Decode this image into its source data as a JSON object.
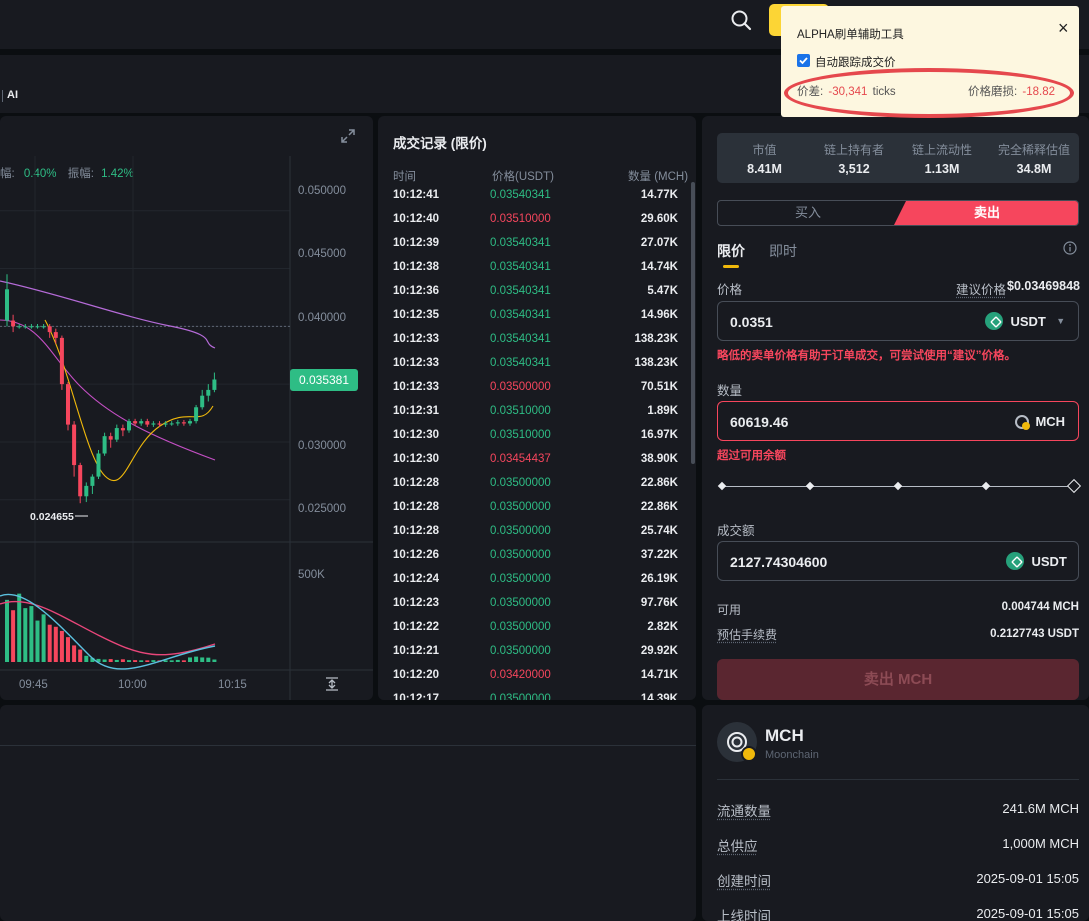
{
  "header": {
    "ai_label": "AI"
  },
  "chart": {
    "stats": {
      "change_label": "幅:",
      "change_value": "0.40%",
      "amplitude_label": "振幅:",
      "amplitude_value": "1.42%"
    },
    "price_ticks": [
      "0.050000",
      "0.045000",
      "0.040000",
      "0.030000",
      "0.025000"
    ],
    "current_price": "0.035381",
    "low_marker": "0.024655",
    "volume_tick": "500K",
    "time_ticks": [
      "09:45",
      "10:00",
      "10:15"
    ]
  },
  "chart_data": {
    "type": "candlestick",
    "y_range": [
      0.021,
      0.053
    ],
    "candles": [
      {
        "o": 0.0405,
        "c": 0.0432,
        "h": 0.0445,
        "l": 0.04
      },
      {
        "o": 0.0405,
        "c": 0.04,
        "h": 0.041,
        "l": 0.0395
      },
      {
        "o": 0.04,
        "c": 0.04,
        "h": 0.0402,
        "l": 0.0398
      },
      {
        "o": 0.04,
        "c": 0.04,
        "h": 0.0402,
        "l": 0.0398
      },
      {
        "o": 0.04,
        "c": 0.04,
        "h": 0.0402,
        "l": 0.0398
      },
      {
        "o": 0.04,
        "c": 0.04,
        "h": 0.0402,
        "l": 0.0398
      },
      {
        "o": 0.04,
        "c": 0.04,
        "h": 0.0402,
        "l": 0.0398
      },
      {
        "o": 0.04,
        "c": 0.0395,
        "h": 0.0402,
        "l": 0.039
      },
      {
        "o": 0.0395,
        "c": 0.039,
        "h": 0.0398,
        "l": 0.0385
      },
      {
        "o": 0.039,
        "c": 0.035,
        "h": 0.0392,
        "l": 0.0345
      },
      {
        "o": 0.035,
        "c": 0.0315,
        "h": 0.0352,
        "l": 0.031
      },
      {
        "o": 0.0315,
        "c": 0.028,
        "h": 0.0318,
        "l": 0.027
      },
      {
        "o": 0.028,
        "c": 0.0253,
        "h": 0.0282,
        "l": 0.0247
      },
      {
        "o": 0.0253,
        "c": 0.0262,
        "h": 0.0265,
        "l": 0.0248
      },
      {
        "o": 0.0262,
        "c": 0.027,
        "h": 0.0272,
        "l": 0.0255
      },
      {
        "o": 0.027,
        "c": 0.029,
        "h": 0.0293,
        "l": 0.0268
      },
      {
        "o": 0.029,
        "c": 0.0305,
        "h": 0.0308,
        "l": 0.0288
      },
      {
        "o": 0.0305,
        "c": 0.0302,
        "h": 0.0308,
        "l": 0.0295
      },
      {
        "o": 0.0302,
        "c": 0.0312,
        "h": 0.0315,
        "l": 0.03
      },
      {
        "o": 0.0312,
        "c": 0.031,
        "h": 0.0315,
        "l": 0.0305
      },
      {
        "o": 0.031,
        "c": 0.0318,
        "h": 0.032,
        "l": 0.0308
      },
      {
        "o": 0.0318,
        "c": 0.0316,
        "h": 0.032,
        "l": 0.0314
      },
      {
        "o": 0.0316,
        "c": 0.0318,
        "h": 0.032,
        "l": 0.0314
      },
      {
        "o": 0.0318,
        "c": 0.0315,
        "h": 0.032,
        "l": 0.0313
      },
      {
        "o": 0.0315,
        "c": 0.0316,
        "h": 0.0318,
        "l": 0.0313
      },
      {
        "o": 0.0316,
        "c": 0.0315,
        "h": 0.0318,
        "l": 0.0313
      },
      {
        "o": 0.0315,
        "c": 0.0316,
        "h": 0.0318,
        "l": 0.0313
      },
      {
        "o": 0.0316,
        "c": 0.0316,
        "h": 0.0318,
        "l": 0.0314
      },
      {
        "o": 0.0316,
        "c": 0.0317,
        "h": 0.0319,
        "l": 0.0314
      },
      {
        "o": 0.0317,
        "c": 0.0316,
        "h": 0.0319,
        "l": 0.0314
      },
      {
        "o": 0.0316,
        "c": 0.0318,
        "h": 0.032,
        "l": 0.0314
      },
      {
        "o": 0.0318,
        "c": 0.033,
        "h": 0.0332,
        "l": 0.0316
      },
      {
        "o": 0.033,
        "c": 0.034,
        "h": 0.0345,
        "l": 0.0328
      },
      {
        "o": 0.034,
        "c": 0.0345,
        "h": 0.035,
        "l": 0.0335
      },
      {
        "o": 0.0345,
        "c": 0.0354,
        "h": 0.036,
        "l": 0.0343
      }
    ],
    "volumes": [
      300,
      250,
      330,
      260,
      270,
      200,
      230,
      180,
      170,
      150,
      120,
      80,
      60,
      30,
      20,
      15,
      12,
      14,
      10,
      13,
      9,
      9,
      8,
      8,
      9,
      8,
      8,
      8,
      10,
      8,
      22,
      26,
      22,
      21,
      12
    ],
    "volume_max": 560
  },
  "trades": {
    "title": "成交记录 (限价)",
    "col_time": "时间",
    "col_price": "价格(USDT)",
    "col_qty": "数量 (MCH)",
    "rows": [
      {
        "time": "10:12:41",
        "price": "0.03540341",
        "qty": "14.77K",
        "side": "buy"
      },
      {
        "time": "10:12:40",
        "price": "0.03510000",
        "qty": "29.60K",
        "side": "sell"
      },
      {
        "time": "10:12:39",
        "price": "0.03540341",
        "qty": "27.07K",
        "side": "buy"
      },
      {
        "time": "10:12:38",
        "price": "0.03540341",
        "qty": "14.74K",
        "side": "buy"
      },
      {
        "time": "10:12:36",
        "price": "0.03540341",
        "qty": "5.47K",
        "side": "buy"
      },
      {
        "time": "10:12:35",
        "price": "0.03540341",
        "qty": "14.96K",
        "side": "buy"
      },
      {
        "time": "10:12:33",
        "price": "0.03540341",
        "qty": "138.23K",
        "side": "buy"
      },
      {
        "time": "10:12:33",
        "price": "0.03540341",
        "qty": "138.23K",
        "side": "buy"
      },
      {
        "time": "10:12:33",
        "price": "0.03500000",
        "qty": "70.51K",
        "side": "sell"
      },
      {
        "time": "10:12:31",
        "price": "0.03510000",
        "qty": "1.89K",
        "side": "buy"
      },
      {
        "time": "10:12:30",
        "price": "0.03510000",
        "qty": "16.97K",
        "side": "buy"
      },
      {
        "time": "10:12:30",
        "price": "0.03454437",
        "qty": "38.90K",
        "side": "sell"
      },
      {
        "time": "10:12:28",
        "price": "0.03500000",
        "qty": "22.86K",
        "side": "buy"
      },
      {
        "time": "10:12:28",
        "price": "0.03500000",
        "qty": "22.86K",
        "side": "buy"
      },
      {
        "time": "10:12:28",
        "price": "0.03500000",
        "qty": "25.74K",
        "side": "buy"
      },
      {
        "time": "10:12:26",
        "price": "0.03500000",
        "qty": "37.22K",
        "side": "buy"
      },
      {
        "time": "10:12:24",
        "price": "0.03500000",
        "qty": "26.19K",
        "side": "buy"
      },
      {
        "time": "10:12:23",
        "price": "0.03500000",
        "qty": "97.76K",
        "side": "buy"
      },
      {
        "time": "10:12:22",
        "price": "0.03500000",
        "qty": "2.82K",
        "side": "buy"
      },
      {
        "time": "10:12:21",
        "price": "0.03500000",
        "qty": "29.92K",
        "side": "buy"
      },
      {
        "time": "10:12:20",
        "price": "0.03420000",
        "qty": "14.71K",
        "side": "sell"
      },
      {
        "time": "10:12:17",
        "price": "0.03500000",
        "qty": "14.39K",
        "side": "buy"
      }
    ]
  },
  "market_stats": [
    {
      "label": "市值",
      "value": "8.41M"
    },
    {
      "label": "链上持有者",
      "value": "3,512"
    },
    {
      "label": "链上流动性",
      "value": "1.13M"
    },
    {
      "label": "完全稀释估值",
      "value": "34.8M"
    }
  ],
  "order": {
    "buy_tab": "买入",
    "sell_tab": "卖出",
    "type_limit": "限价",
    "type_market": "即时",
    "price_label": "价格",
    "suggested_label": "建议价格",
    "suggested_value": "$0.03469848",
    "price_value": "0.0351",
    "price_unit": "USDT",
    "price_warning": "略低的卖单价格有助于订单成交，可尝试使用“建议”价格。",
    "qty_label": "数量",
    "qty_value": "60619.46",
    "qty_unit": "MCH",
    "qty_error": "超过可用余额",
    "total_label": "成交额",
    "total_value": "2127.74304600",
    "total_unit": "USDT",
    "available_label": "可用",
    "available_value": "0.004744 MCH",
    "fee_label": "预估手续费",
    "fee_value": "0.2127743 USDT",
    "submit_label": "卖出 MCH",
    "slider_pct": 1.0
  },
  "token": {
    "symbol": "MCH",
    "name": "Moonchain",
    "rows": [
      {
        "label": "流通数量",
        "value": "241.6M MCH"
      },
      {
        "label": "总供应",
        "value": "1,000M MCH"
      },
      {
        "label": "创建时间",
        "value": "2025-09-01 15:05"
      },
      {
        "label": "上线时间",
        "value": "2025-09-01 15:05"
      }
    ]
  },
  "popup": {
    "title": "ALPHA刷单辅助工具",
    "checkbox_label": "自动跟踪成交价",
    "checkbox_checked": true,
    "spread_label": "价差:",
    "spread_value": "-30,341",
    "spread_unit": "ticks",
    "slippage_label": "价格磨损:",
    "slippage_value": "-18.82",
    "close_label": "×"
  },
  "colors": {
    "up": "#2ebd85",
    "down": "#f6465d",
    "accent": "#f0b90b",
    "bg": "#0b0e11",
    "panel": "#181a20"
  }
}
